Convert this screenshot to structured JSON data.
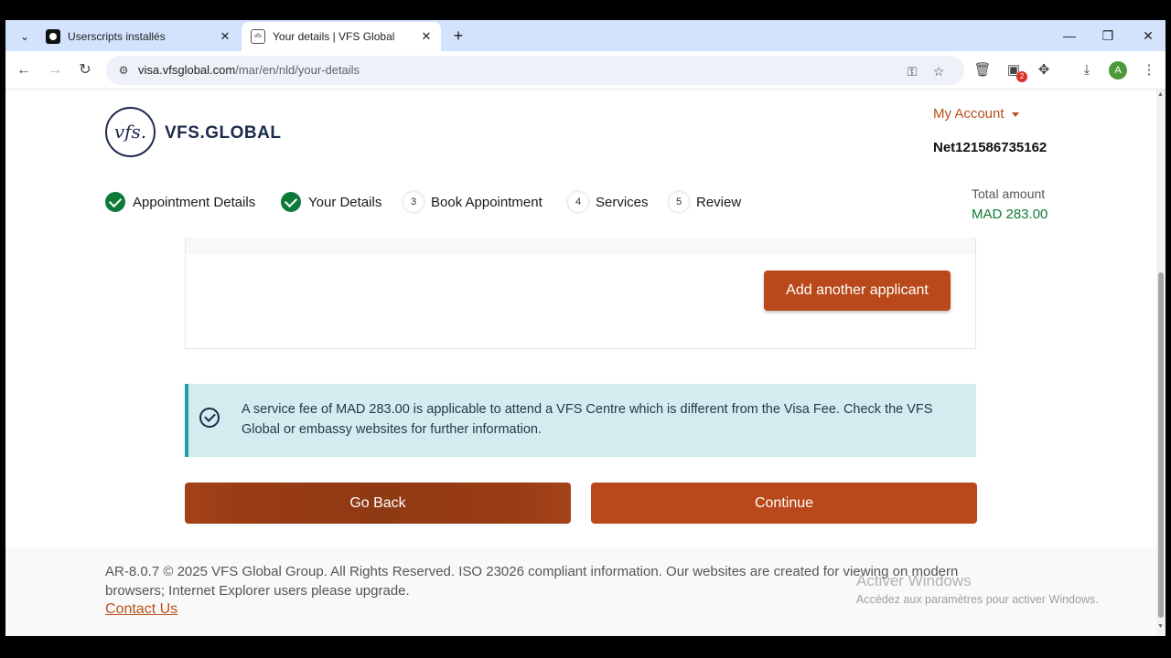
{
  "browser": {
    "tabs": [
      {
        "title": "Userscripts installés",
        "active": false
      },
      {
        "title": "Your details | VFS Global",
        "active": true
      }
    ],
    "url_host": "visa.vfsglobal.com",
    "url_path": "/mar/en/nld/your-details",
    "extensions_badge": "2",
    "profile_initial": "A"
  },
  "header": {
    "logo_mark": "vfs.",
    "logo_text": "VFS.GLOBAL",
    "my_account": "My Account",
    "account_id": "Net121586735162"
  },
  "steps": [
    {
      "label": "Appointment Details",
      "state": "done"
    },
    {
      "label": "Your Details",
      "state": "done"
    },
    {
      "number": "3",
      "label": "Book Appointment",
      "state": "pending"
    },
    {
      "number": "4",
      "label": "Services",
      "state": "pending"
    },
    {
      "number": "5",
      "label": "Review",
      "state": "pending"
    }
  ],
  "total": {
    "label": "Total amount",
    "value": "MAD 283.00"
  },
  "card": {
    "add_applicant": "Add another applicant"
  },
  "notice": {
    "text": "A service fee of MAD 283.00 is applicable to attend a VFS Centre which is different from the Visa Fee. Check the VFS Global or embassy websites for further information."
  },
  "actions": {
    "back": "Go Back",
    "continue": "Continue"
  },
  "footer": {
    "text": "AR-8.0.7 © 2025 VFS Global Group. All Rights Reserved. ISO 23026 compliant information. Our websites are created for viewing on modern browsers; Internet Explorer users please upgrade.",
    "contact": "Contact Us"
  },
  "watermark": {
    "line1": "Activer Windows",
    "line2": "Accédez aux paramètres pour activer Windows."
  },
  "colors": {
    "brand": "#b9481a",
    "success": "#0d7a3a",
    "notice_bg": "#d4ecef",
    "notice_border": "#18a2ad"
  }
}
